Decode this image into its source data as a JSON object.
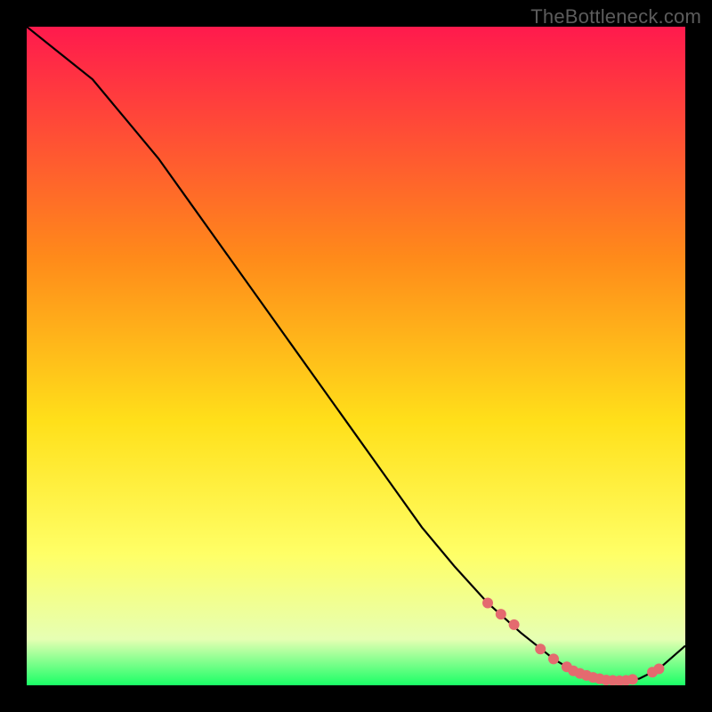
{
  "watermark": "TheBottleneck.com",
  "chart_data": {
    "type": "line",
    "title": "",
    "xlabel": "",
    "ylabel": "",
    "xlim": [
      0,
      100
    ],
    "ylim": [
      0,
      100
    ],
    "grid": false,
    "series": [
      {
        "name": "bottleneck-curve",
        "x": [
          0,
          5,
          10,
          15,
          20,
          25,
          30,
          35,
          40,
          45,
          50,
          55,
          60,
          65,
          70,
          75,
          80,
          83,
          86,
          88,
          90,
          93,
          96,
          100
        ],
        "y": [
          100,
          96,
          92,
          86,
          80,
          73,
          66,
          59,
          52,
          45,
          38,
          31,
          24,
          18,
          12.5,
          8,
          4,
          2.2,
          1.2,
          0.8,
          0.7,
          1.0,
          2.5,
          6
        ]
      }
    ],
    "markers": {
      "name": "highlighted-segment",
      "x": [
        70,
        72,
        74,
        78,
        80,
        82,
        83,
        84,
        85,
        86,
        87,
        88,
        89,
        90,
        91,
        92,
        95,
        96
      ],
      "y": [
        12.5,
        10.8,
        9.2,
        5.5,
        4,
        2.8,
        2.2,
        1.8,
        1.5,
        1.2,
        1.0,
        0.8,
        0.75,
        0.7,
        0.75,
        0.9,
        2.0,
        2.5
      ]
    },
    "background_gradient": {
      "top": "#ff1a4d",
      "mid_upper": "#ff8a1a",
      "mid": "#ffe01a",
      "mid_lower": "#ffff66",
      "lower": "#e6ffb3",
      "bottom": "#1aff66"
    }
  }
}
